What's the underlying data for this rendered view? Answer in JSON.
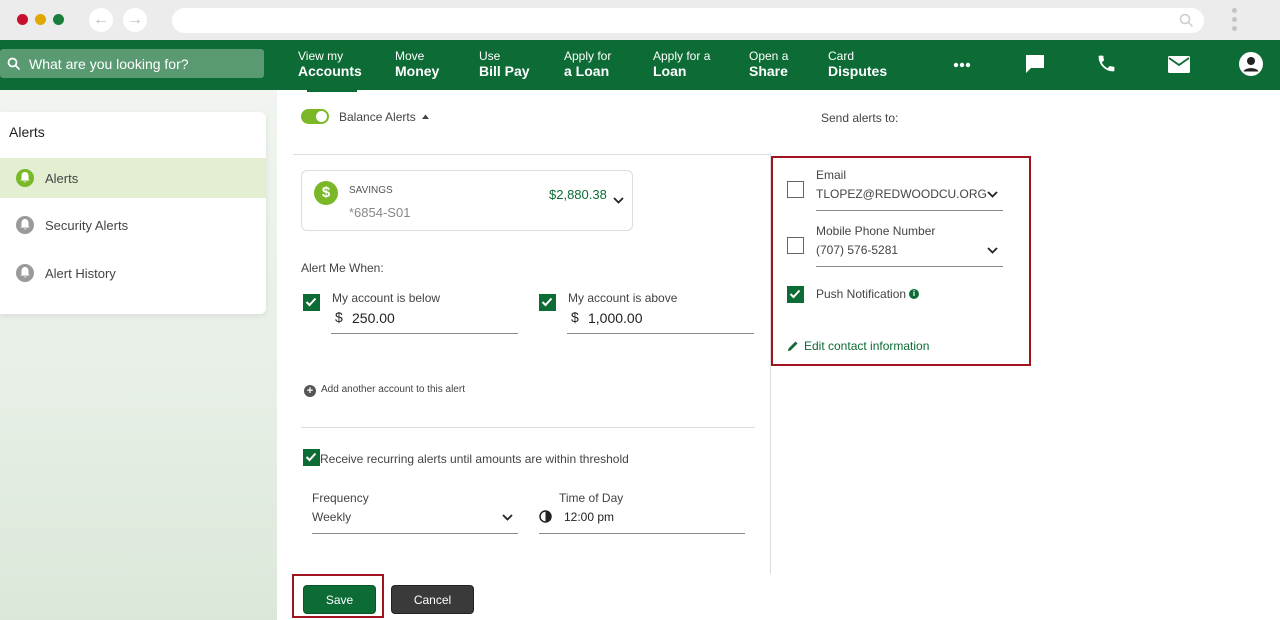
{
  "topnav": {
    "search_placeholder": "What are you looking for?",
    "links": [
      {
        "line1": "View my",
        "line2": "Accounts"
      },
      {
        "line1": "Move",
        "line2": "Money"
      },
      {
        "line1": "Use",
        "line2": "Bill Pay"
      },
      {
        "line1": "Apply for",
        "line2": "a Loan"
      },
      {
        "line1": "Apply for a",
        "line2": "Loan"
      },
      {
        "line1": "Open a",
        "line2": "Share"
      },
      {
        "line1": "Card",
        "line2": "Disputes"
      }
    ],
    "icons": [
      "more-icon",
      "chat-icon",
      "phone-icon",
      "mail-icon",
      "profile-icon"
    ]
  },
  "sidebar": {
    "title": "Alerts",
    "items": [
      {
        "label": "Alerts",
        "active": true
      },
      {
        "label": "Security Alerts",
        "active": false
      },
      {
        "label": "Alert History",
        "active": false
      }
    ]
  },
  "alert": {
    "toggle_label": "Balance Alerts",
    "toggle_on": true,
    "send_to_label": "Send alerts to:",
    "account": {
      "type": "SAVINGS",
      "number": "*6854-S01",
      "balance": "$2,880.38"
    },
    "alert_me_when": "Alert Me When:",
    "below": {
      "checked": true,
      "label": "My account is below",
      "currency": "$",
      "value": "250.00"
    },
    "above": {
      "checked": true,
      "label": "My account is above",
      "currency": "$",
      "value": "1,000.00"
    },
    "add_account": "Add another account to this alert",
    "recurring": {
      "checked": true,
      "label": "Receive recurring alerts until amounts are within threshold"
    },
    "frequency": {
      "label": "Frequency",
      "value": "Weekly"
    },
    "time_of_day": {
      "label": "Time of Day",
      "value": "12:00  pm"
    }
  },
  "contacts": {
    "email": {
      "checked": false,
      "label": "Email",
      "value": "TLOPEZ@REDWOODCU.ORG"
    },
    "phone": {
      "checked": false,
      "label": "Mobile Phone Number",
      "value": "(707) 576-5281"
    },
    "push": {
      "checked": true,
      "label": "Push Notification"
    },
    "edit_link": "Edit contact information"
  },
  "buttons": {
    "save": "Save",
    "cancel": "Cancel"
  },
  "colors": {
    "brand_green": "#0d6b35",
    "accent_green": "#7ab828",
    "highlight_red": "#a0141e"
  }
}
